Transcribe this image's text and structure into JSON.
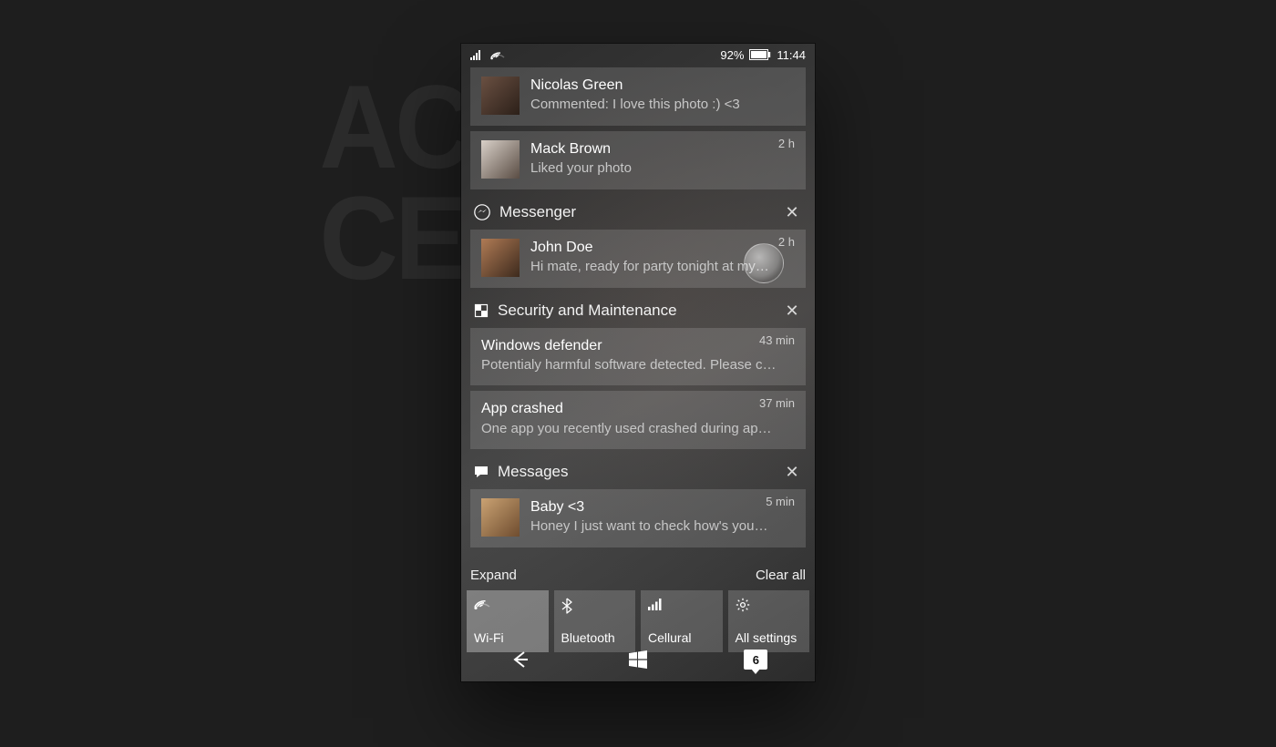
{
  "bg_text": {
    "line1": "ACTION",
    "line2": "CENTER"
  },
  "statusbar": {
    "battery": "92%",
    "time": "11:44"
  },
  "partial_group": {
    "items": [
      {
        "name": "Nicolas Green",
        "detail": "Commented: I love this photo :) <3",
        "time": ""
      },
      {
        "name": "Mack Brown",
        "detail": "Liked your photo",
        "time": "2 h"
      }
    ]
  },
  "groups": [
    {
      "id": "messenger",
      "icon": "messenger-icon",
      "title": "Messenger",
      "items": [
        {
          "name": "John Doe",
          "detail": "Hi mate, ready for party tonight at my…",
          "time": "2 h",
          "avatar": true,
          "touch": true
        }
      ]
    },
    {
      "id": "security",
      "icon": "shield-icon",
      "title": "Security and Maintenance",
      "items": [
        {
          "name": "Windows defender",
          "detail": "Potentialy harmful software detected. Please  c…",
          "time": "43 min",
          "avatar": false
        },
        {
          "name": "App crashed",
          "detail": "One app you recently used crashed during  ap…",
          "time": "37 min",
          "avatar": false
        }
      ]
    },
    {
      "id": "messages",
      "icon": "chat-icon",
      "title": "Messages",
      "items": [
        {
          "name": "Baby <3",
          "detail": "Honey I just want to check how's you…",
          "time": "5 min",
          "avatar": true
        }
      ]
    }
  ],
  "footer": {
    "expand": "Expand",
    "clear": "Clear all"
  },
  "tiles": [
    {
      "icon": "wifi-icon",
      "label": "Wi-Fi",
      "active": true
    },
    {
      "icon": "bluetooth-icon",
      "label": "Bluetooth",
      "active": false
    },
    {
      "icon": "cellular-icon",
      "label": "Cellural",
      "active": false
    },
    {
      "icon": "settings-icon",
      "label": "All settings",
      "active": false
    }
  ],
  "nav": {
    "search_badge": "6"
  }
}
